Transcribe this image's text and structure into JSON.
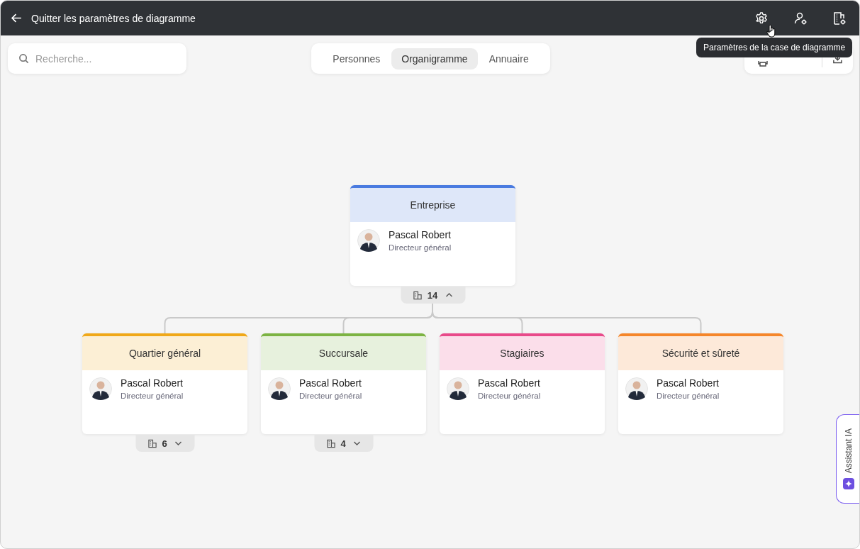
{
  "header": {
    "title": "Quitter les paramètres de diagramme"
  },
  "tooltip": "Paramètres de la case de diagramme",
  "search": {
    "placeholder": "Recherche..."
  },
  "tabs": [
    {
      "label": "Personnes",
      "selected": false
    },
    {
      "label": "Organigramme",
      "selected": true
    },
    {
      "label": "Annuaire",
      "selected": false
    }
  ],
  "chart": {
    "root": {
      "title": "Entreprise",
      "color": "#4a7be0",
      "person": "Pascal Robert",
      "role": "Directeur général",
      "count": "14",
      "expanded": true
    },
    "children": [
      {
        "title": "Quartier général",
        "color": "#f0a818",
        "person": "Pascal Robert",
        "role": "Directeur général",
        "count": "6",
        "expanded": false
      },
      {
        "title": "Succursale",
        "color": "#7cb342",
        "person": "Pascal Robert",
        "role": "Directeur général",
        "count": "4",
        "expanded": false
      },
      {
        "title": "Stagiaires",
        "color": "#e84a8a",
        "person": "Pascal Robert",
        "role": "Directeur général"
      },
      {
        "title": "Sécurité et sûreté",
        "color": "#f5862a",
        "person": "Pascal Robert",
        "role": "Directeur général"
      }
    ]
  },
  "assistant": "Assistant IA"
}
